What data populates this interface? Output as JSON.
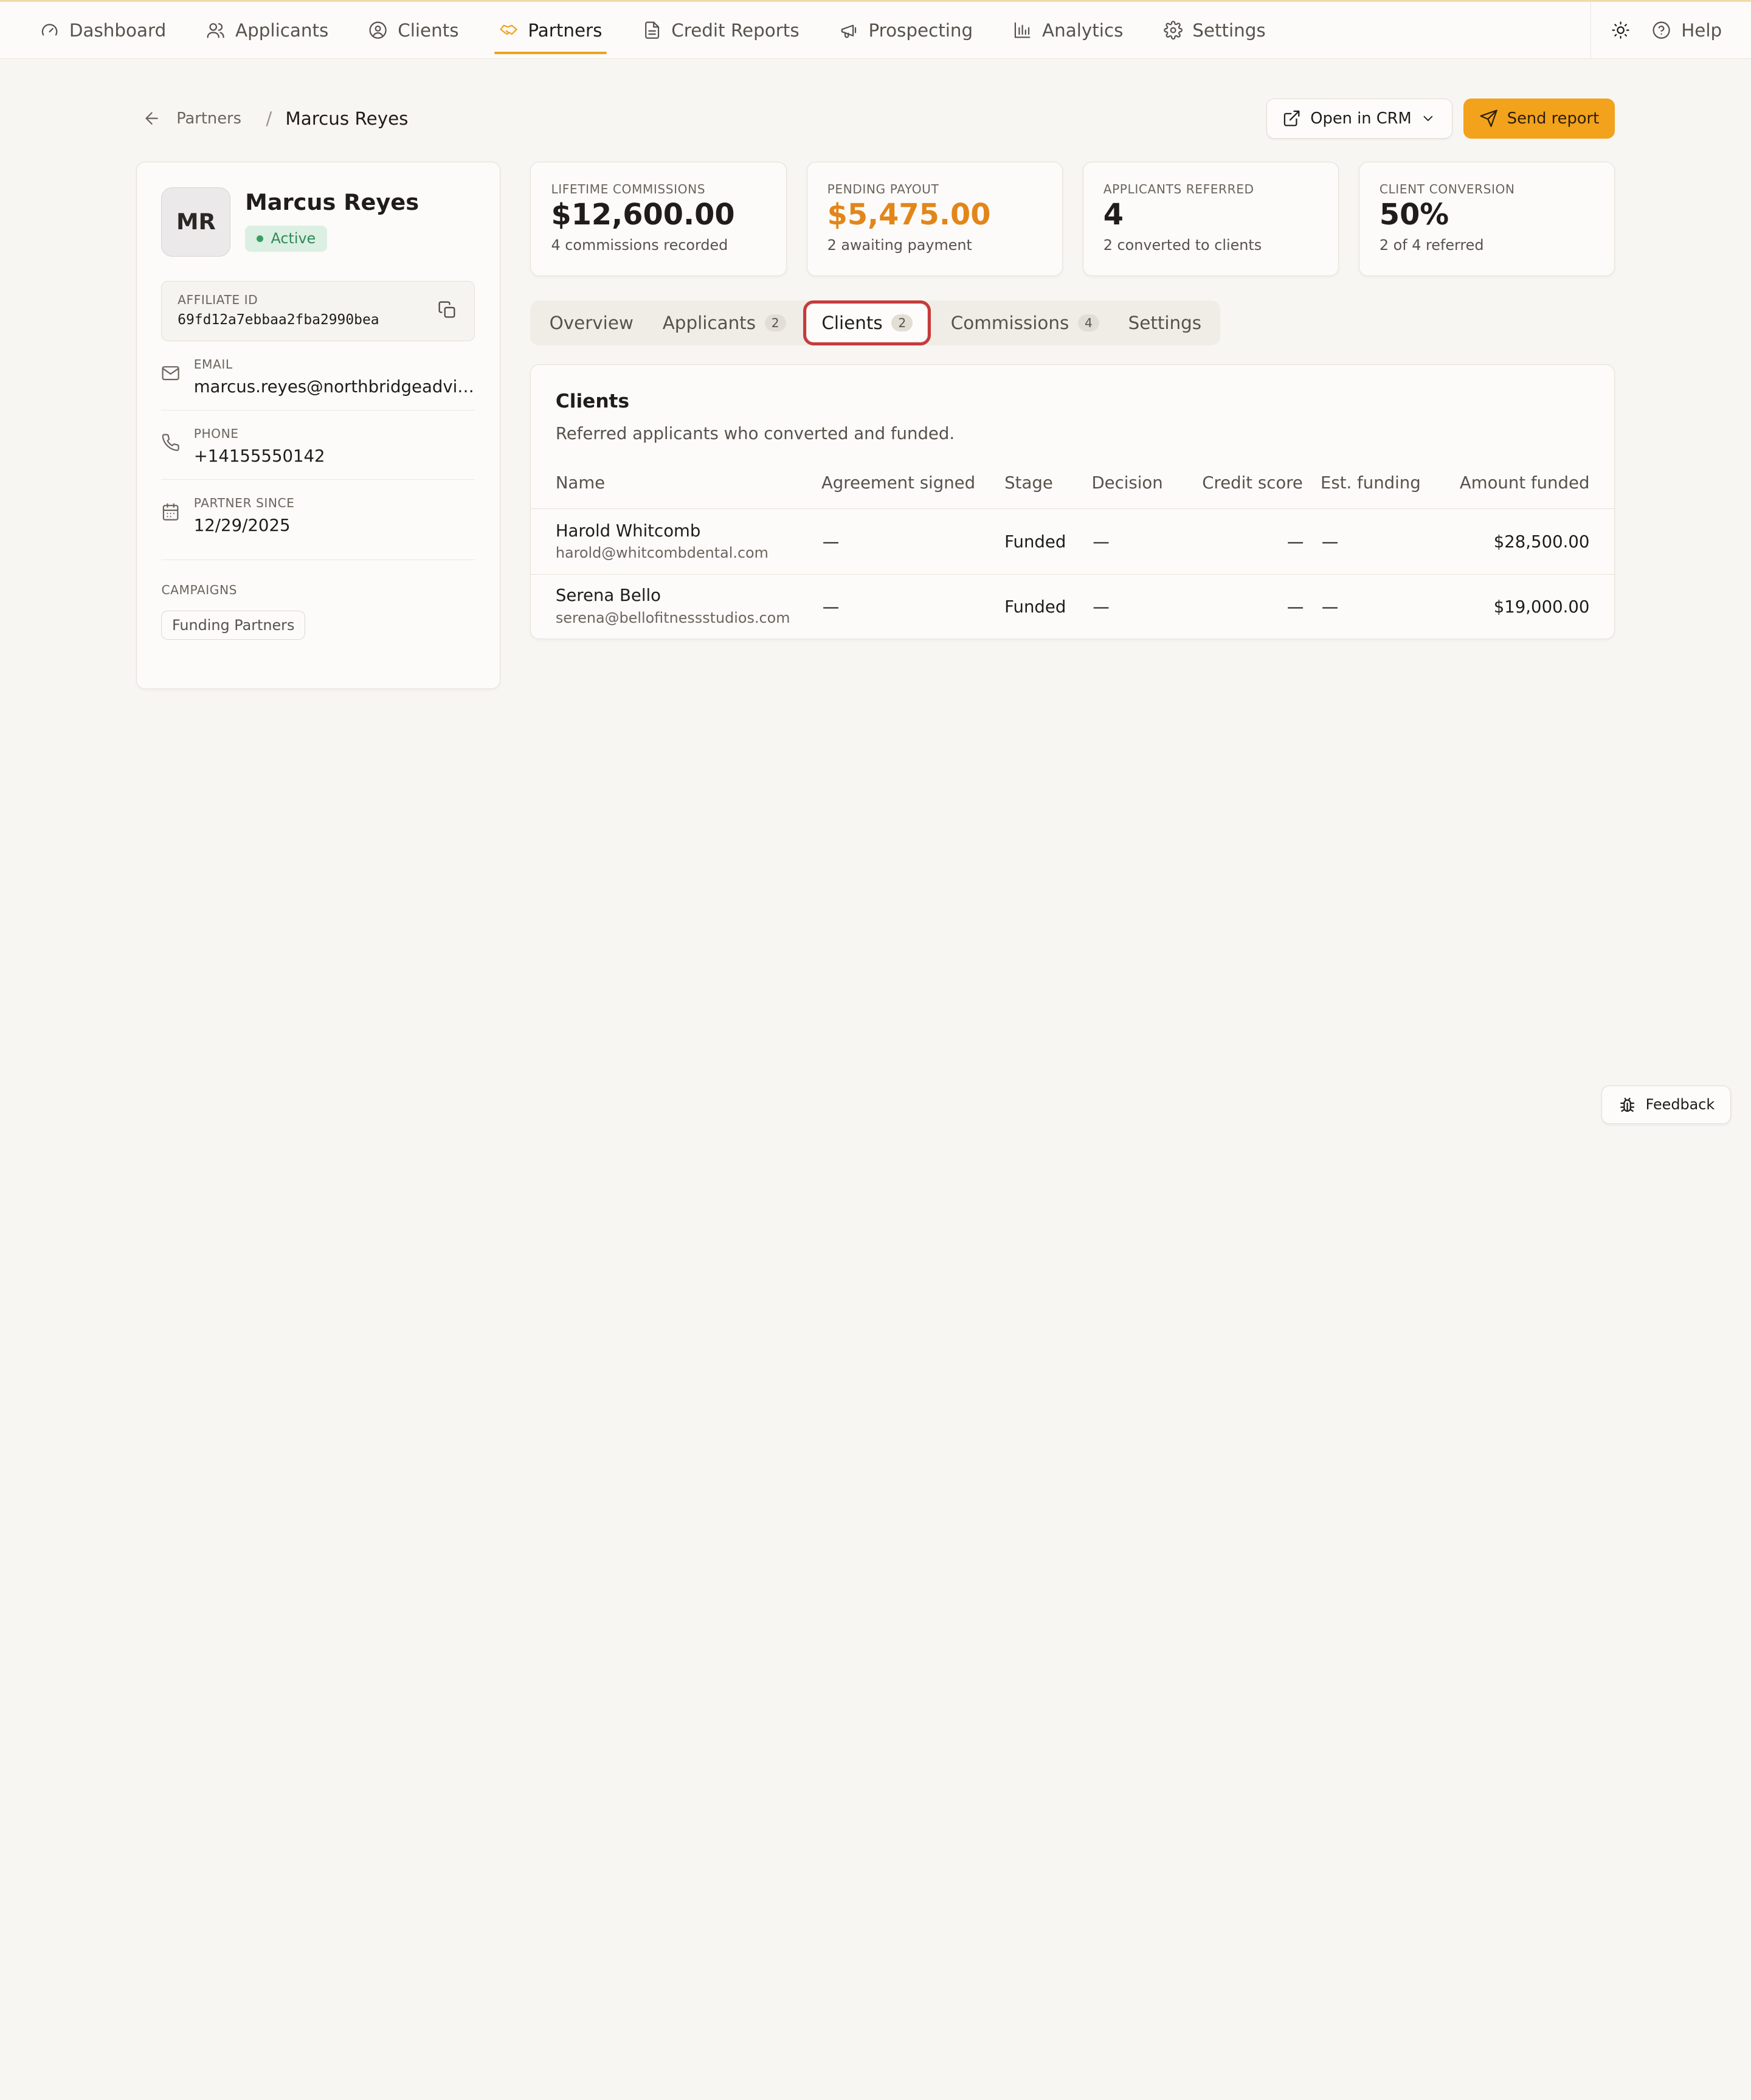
{
  "nav": {
    "items": [
      {
        "label": "Dashboard",
        "icon": "gauge-icon"
      },
      {
        "label": "Applicants",
        "icon": "users-icon"
      },
      {
        "label": "Clients",
        "icon": "user-circle-icon"
      },
      {
        "label": "Partners",
        "icon": "handshake-icon",
        "active": true
      },
      {
        "label": "Credit Reports",
        "icon": "file-icon"
      },
      {
        "label": "Prospecting",
        "icon": "megaphone-icon"
      },
      {
        "label": "Analytics",
        "icon": "bar-chart-icon"
      },
      {
        "label": "Settings",
        "icon": "gear-icon"
      }
    ],
    "help_label": "Help",
    "accent": "#f0a21c"
  },
  "breadcrumb": {
    "parent": "Partners",
    "separator": "/",
    "current": "Marcus Reyes"
  },
  "actions": {
    "crm_label": "Open in CRM",
    "send_label": "Send report"
  },
  "profile": {
    "initials": "MR",
    "name": "Marcus Reyes",
    "status": "Active",
    "affiliate_label": "AFFILIATE ID",
    "affiliate_id": "69fd12a7ebbaa2fba2990bea",
    "email_label": "EMAIL",
    "email": "marcus.reyes@northbridgeadvisors.com",
    "phone_label": "PHONE",
    "phone": "+14155550142",
    "since_label": "PARTNER SINCE",
    "since": "12/29/2025",
    "campaigns_label": "CAMPAIGNS",
    "campaign": "Funding Partners"
  },
  "stats": [
    {
      "label": "LIFETIME COMMISSIONS",
      "value": "$12,600.00",
      "sub": "4 commissions recorded"
    },
    {
      "label": "PENDING PAYOUT",
      "value": "$5,475.00",
      "sub": "2 awaiting payment",
      "color": "#e2861a"
    },
    {
      "label": "APPLICANTS REFERRED",
      "value": "4",
      "sub": "2 converted to clients"
    },
    {
      "label": "CLIENT CONVERSION",
      "value": "50%",
      "sub": "2 of 4 referred"
    }
  ],
  "tabs": [
    {
      "label": "Overview"
    },
    {
      "label": "Applicants",
      "count": "2"
    },
    {
      "label": "Clients",
      "count": "2",
      "active": true
    },
    {
      "label": "Commissions",
      "count": "4"
    },
    {
      "label": "Settings"
    }
  ],
  "clients": {
    "title": "Clients",
    "subtitle": "Referred applicants who converted and funded.",
    "columns": [
      "Name",
      "Agreement signed",
      "Stage",
      "Decision",
      "Credit score",
      "Est. funding",
      "Amount funded"
    ],
    "rows": [
      {
        "name": "Harold Whitcomb",
        "email": "harold@whitcombdental.com",
        "agreement": "—",
        "stage": "Funded",
        "decision": "—",
        "credit": "—",
        "est": "—",
        "amount": "$28,500.00"
      },
      {
        "name": "Serena Bello",
        "email": "serena@bellofitnessstudios.com",
        "agreement": "—",
        "stage": "Funded",
        "decision": "—",
        "credit": "—",
        "est": "—",
        "amount": "$19,000.00"
      }
    ]
  },
  "feedback_label": "Feedback"
}
